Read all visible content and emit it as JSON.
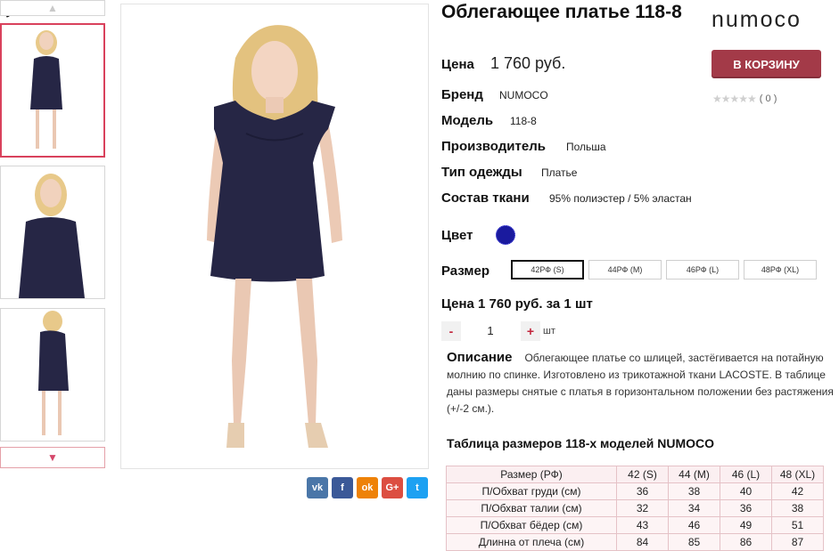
{
  "product": {
    "title": "Облегающее платье 118-8",
    "brand_logo": "numoco",
    "cart_button": "В КОРЗИНУ",
    "rating_count": "( 0 )",
    "rating_value": 0,
    "rating_max": 5,
    "price_label": "Цена",
    "price_value": "1 760 руб.",
    "specs": [
      {
        "label": "Бренд",
        "value": "NUMOCO"
      },
      {
        "label": "Модель",
        "value": "118-8"
      },
      {
        "label": "Производитель",
        "value": "Польша"
      },
      {
        "label": "Тип одежды",
        "value": "Платье"
      },
      {
        "label": "Состав ткани",
        "value": "95% полиэстер / 5% эластан"
      }
    ],
    "color_label": "Цвет",
    "color_hex": "#1a1a9e",
    "size_label": "Размер",
    "sizes": [
      "42РФ (S)",
      "44РФ (M)",
      "46РФ (L)",
      "48РФ (XL)"
    ],
    "selected_size": "42РФ (S)",
    "unit_price_text": "Цена 1 760 руб. за 1 шт",
    "quantity": {
      "minus": "-",
      "value": "1",
      "plus": "+",
      "unit": "шт"
    },
    "description_label": "Описание",
    "description_text": "Облегающее платье со шлицей, застёгивается на потайную молнию по спинке. Изготовлено из трикотажной ткани LACOSTE.  В таблице даны размеры снятые с платья в горизонтальном положении без растяжения (+/-2 см.).",
    "size_table_title": "Таблица размеров 118-х моделей NUMOCO",
    "size_table": {
      "header": [
        "Размер (РФ)",
        "42 (S)",
        "44 (M)",
        "46 (L)",
        "48 (XL)"
      ],
      "rows": [
        [
          "П/Обхват груди (см)",
          "36",
          "38",
          "40",
          "42"
        ],
        [
          "П/Обхват талии (см)",
          "32",
          "34",
          "36",
          "38"
        ],
        [
          "П/Обхват бёдер (см)",
          "43",
          "46",
          "49",
          "51"
        ],
        [
          "Длинна от плеча (см)",
          "84",
          "85",
          "86",
          "87"
        ]
      ]
    }
  },
  "gallery": {
    "thumbnails": [
      "front-view",
      "front-closeup",
      "back-view"
    ],
    "active_index": 0,
    "social": [
      {
        "icon": "vk-icon",
        "glyph": "vk",
        "color": "#4a76a8"
      },
      {
        "icon": "facebook-icon",
        "glyph": "f",
        "color": "#3b5998"
      },
      {
        "icon": "odnoklassniki-icon",
        "glyph": "ok",
        "color": "#ee8208"
      },
      {
        "icon": "google-plus-icon",
        "glyph": "G+",
        "color": "#dc4e41"
      },
      {
        "icon": "twitter-icon",
        "glyph": "t",
        "color": "#1da1f2"
      }
    ]
  },
  "colors": {
    "accent": "#a33a48",
    "active_border": "#d9415c",
    "dress": "#262645"
  }
}
